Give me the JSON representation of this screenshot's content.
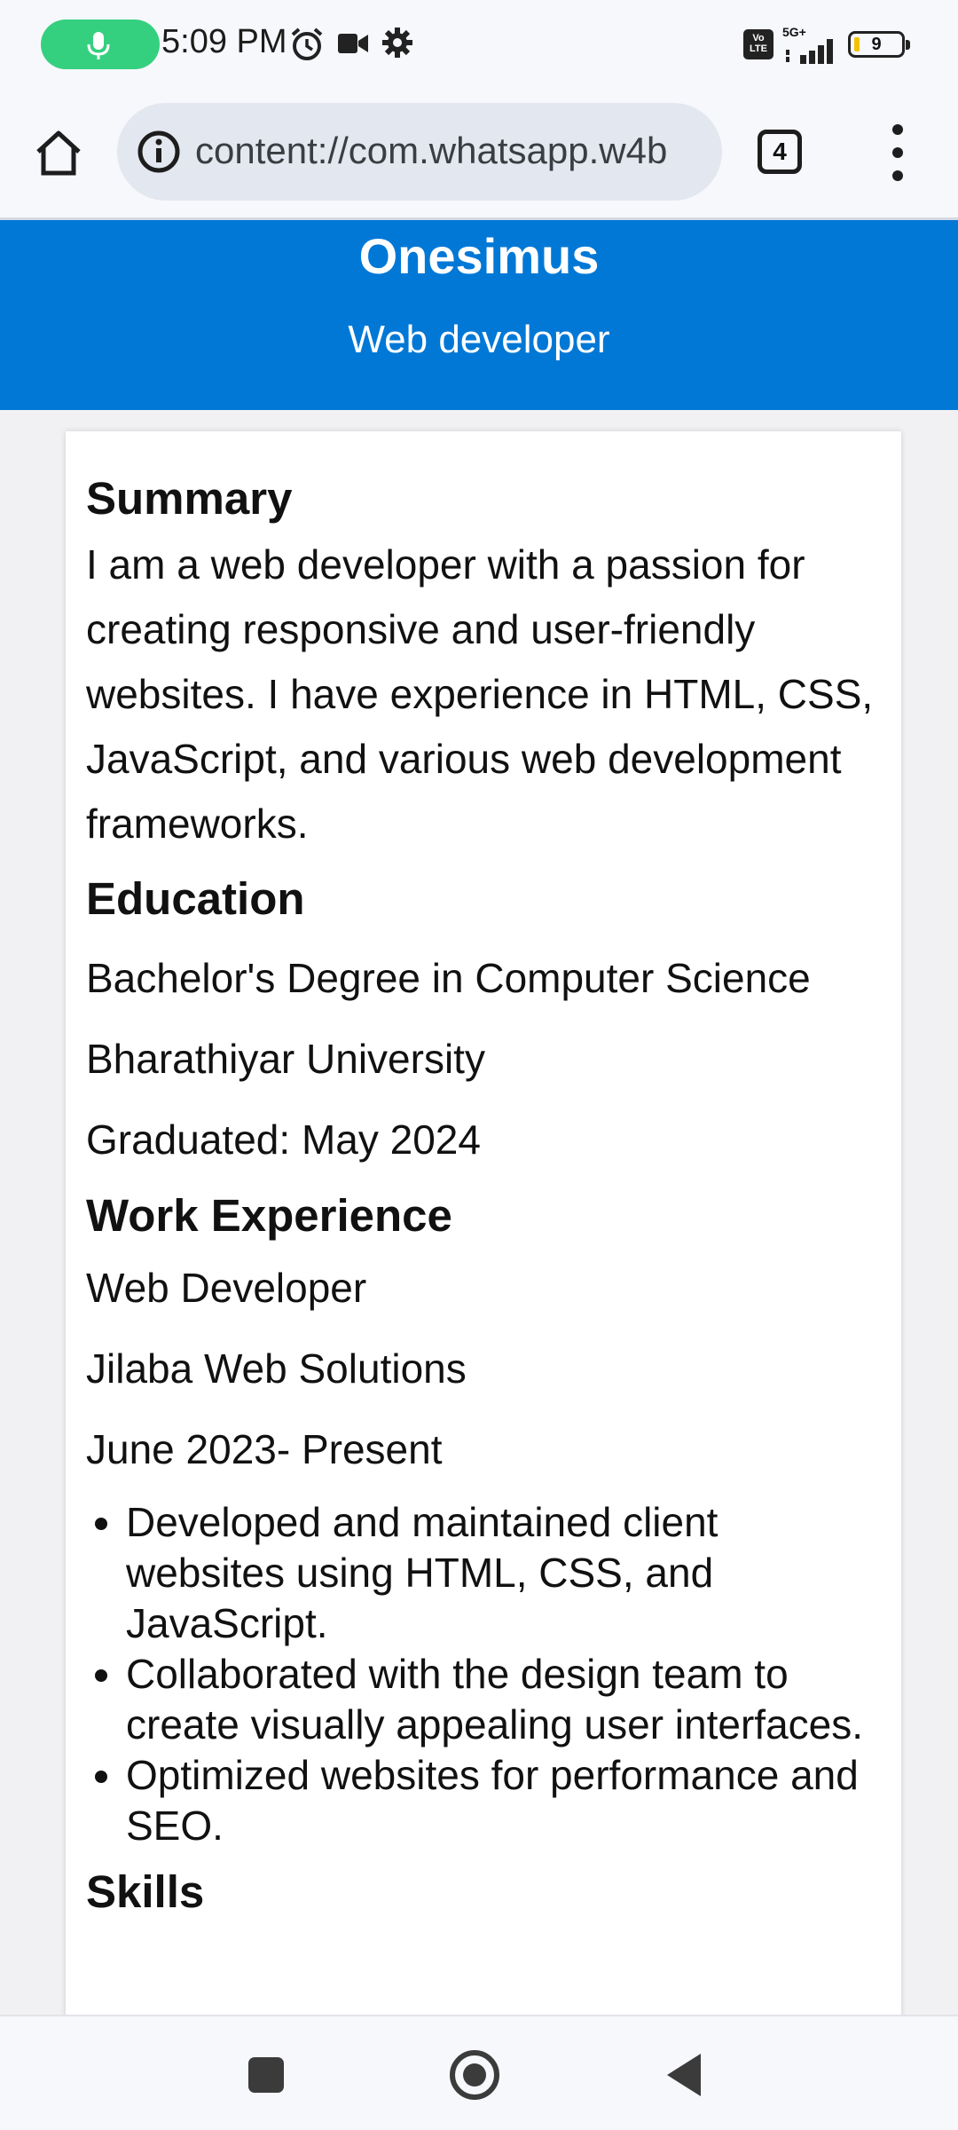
{
  "status_bar": {
    "time": "5:09 PM",
    "network": "5G+",
    "volte": "Vo LTE",
    "battery": "9",
    "icons": [
      "mic-icon",
      "alarm-icon",
      "video-camera-icon",
      "settings-gear-icon",
      "volte-icon",
      "signal-icon",
      "battery-icon"
    ]
  },
  "browser": {
    "url": "content://com.whatsapp.w4b",
    "tab_count": "4",
    "icons": [
      "home-icon",
      "info-icon",
      "tabs-icon",
      "more-vert-icon"
    ]
  },
  "resume": {
    "name": "Onesimus",
    "role": "Web developer",
    "summary": {
      "heading": "Summary",
      "text": "I am a web developer with a passion for creating responsive and user-friendly websites. I have experience in HTML, CSS, JavaScript, and various web development frameworks."
    },
    "education": {
      "heading": "Education",
      "degree": "Bachelor's Degree in Computer Science",
      "school": "Bharathiyar University",
      "graduated": "Graduated: May 2024"
    },
    "work": {
      "heading": "Work Experience",
      "title": "Web Developer",
      "company": "Jilaba Web Solutions",
      "dates": "June 2023- Present",
      "bullets": [
        "Developed and maintained client websites using HTML, CSS, and JavaScript.",
        "Collaborated with the design team to create visually appealing user interfaces.",
        "Optimized websites for performance and SEO."
      ]
    },
    "skills": {
      "heading": "Skills"
    }
  },
  "colors": {
    "header_bg": "#0278d6",
    "mic_pill": "#35d07f",
    "battery_level": "#f2c200"
  },
  "nav_bar": {
    "icons": [
      "recents-square-icon",
      "home-circle-icon",
      "back-triangle-icon"
    ]
  }
}
